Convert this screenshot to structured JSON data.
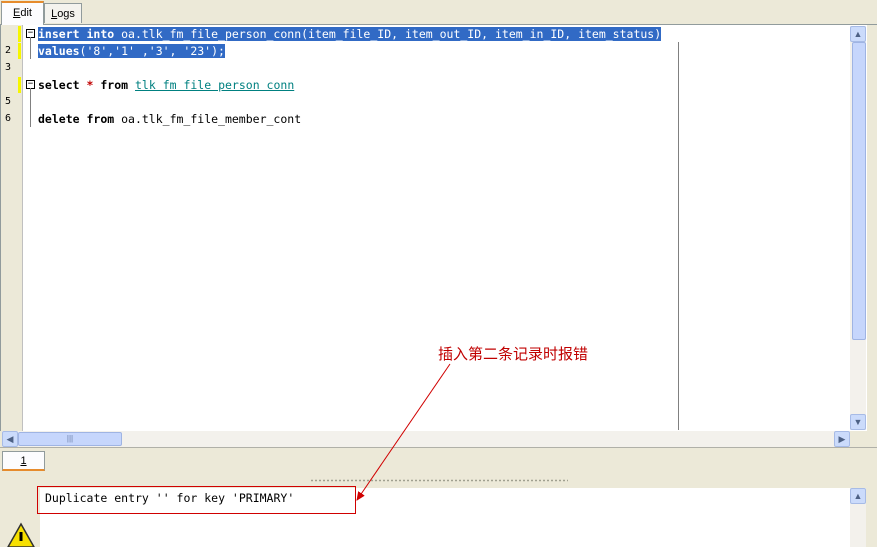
{
  "tabs": [
    {
      "label_prefix": "",
      "label_ul": "E",
      "label_rest": "dit"
    },
    {
      "label_prefix": "",
      "label_ul": "L",
      "label_rest": "ogs"
    }
  ],
  "editor": {
    "lines": [
      {
        "no": "",
        "parts": [
          {
            "t": "insert",
            "c": "kw"
          },
          {
            "t": " "
          },
          {
            "t": "into",
            "c": "kw"
          },
          {
            "t": " oa.tlk_fm_file_person_conn(item_file_ID, item_out_ID, item_in_ID, item_status)"
          }
        ],
        "selected": true
      },
      {
        "no": "2",
        "parts": [
          {
            "t": "values",
            "c": "kw"
          },
          {
            "t": "('8','1' ,'3', '23');"
          }
        ],
        "selected": true
      },
      {
        "no": "3",
        "parts": []
      },
      {
        "no": "",
        "parts": [
          {
            "t": "select",
            "c": "kw"
          },
          {
            "t": " "
          },
          {
            "t": "*",
            "c": "star"
          },
          {
            "t": " "
          },
          {
            "t": "from",
            "c": "kw"
          },
          {
            "t": " "
          },
          {
            "t": "tlk fm file person conn",
            "c": "link"
          }
        ]
      },
      {
        "no": "5",
        "parts": []
      },
      {
        "no": "6",
        "parts": [
          {
            "t": "delete",
            "c": "kw"
          },
          {
            "t": " "
          },
          {
            "t": "from",
            "c": "kw"
          },
          {
            "t": " oa.tlk_fm_file_member_cont"
          }
        ]
      }
    ]
  },
  "scroll": {
    "up": "▲",
    "down": "▼",
    "left": "◀",
    "right": "▶",
    "grip": "|||"
  },
  "result_tab": "1",
  "message": "Duplicate entry '' for key 'PRIMARY'",
  "annotation": "插入第二条记录时报错",
  "icons": {
    "warning": "warning-icon"
  }
}
